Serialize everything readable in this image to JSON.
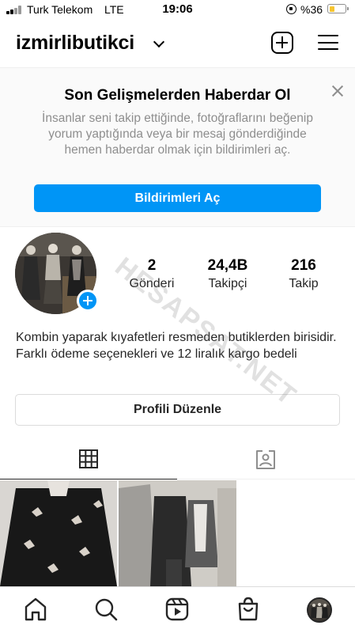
{
  "status_bar": {
    "carrier": "Turk Telekom",
    "network": "LTE",
    "time": "19:06",
    "battery": "%36",
    "battery_level": 0.36
  },
  "header": {
    "username": "izmirlibutikci"
  },
  "notification": {
    "title": "Son Gelişmelerden Haberdar Ol",
    "text": "İnsanlar seni takip ettiğinde, fotoğraflarını beğenip yorum yaptığında veya bir mesaj gönderdiğinde hemen haberdar olmak için bildirimleri aç.",
    "button": "Bildirimleri Aç"
  },
  "profile": {
    "stats": [
      {
        "value": "2",
        "label": "Gönderi"
      },
      {
        "value": "24,4B",
        "label": "Takipçi"
      },
      {
        "value": "216",
        "label": "Takip"
      }
    ],
    "bio": "Kombin yaparak kıyafetleri resmeden butiklerden birisidir. Farklı ödeme seçenekleri ve 12 liralık kargo bedeli",
    "edit_button": "Profili Düzenle"
  },
  "watermark": "HESAPSAT.NET",
  "colors": {
    "accent": "#0095f6",
    "text": "#262626",
    "muted": "#8e8e8e",
    "battery": "#f7c531"
  }
}
